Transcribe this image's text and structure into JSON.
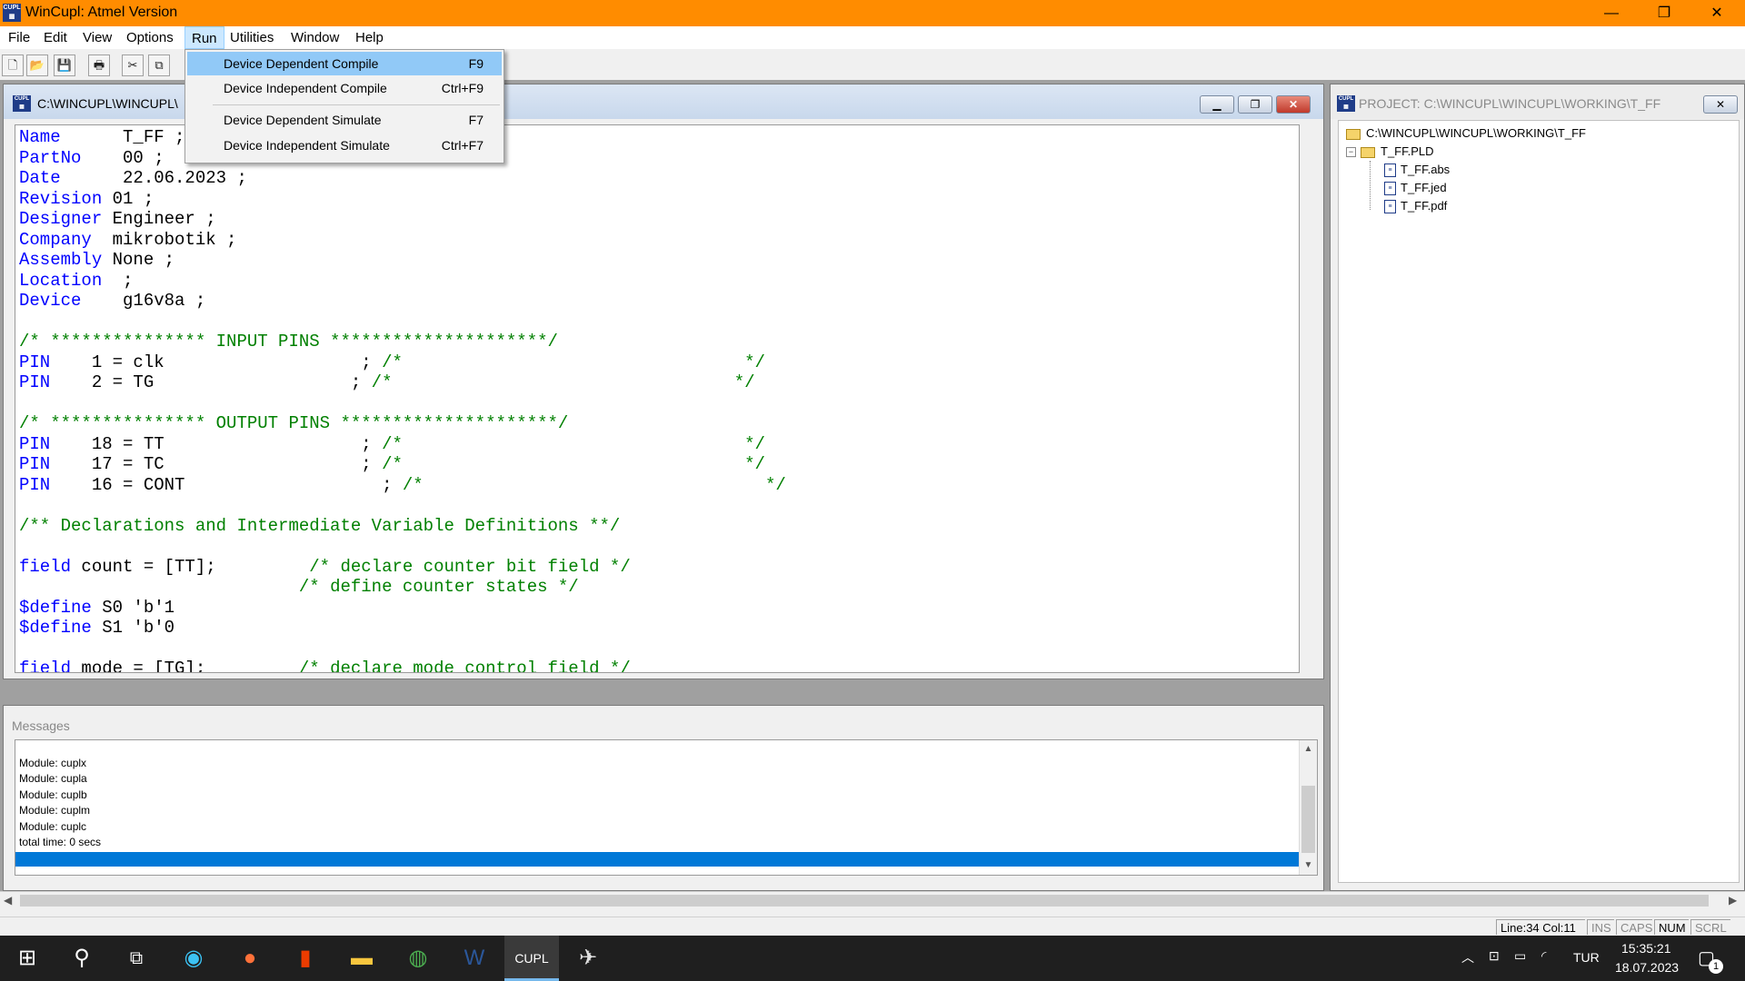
{
  "window": {
    "title": "WinCupl:  Atmel Version",
    "minimize": "—",
    "maximize": "❐",
    "close": "✕"
  },
  "menu": [
    "File",
    "Edit",
    "View",
    "Options",
    "Run",
    "Utilities",
    "Window",
    "Help"
  ],
  "run_menu": [
    {
      "label": "Device Dependent Compile",
      "shortcut": "F9"
    },
    {
      "label": "Device Independent Compile",
      "shortcut": "Ctrl+F9"
    },
    {
      "label": "Device Dependent Simulate",
      "shortcut": "F7"
    },
    {
      "label": "Device Independent Simulate",
      "shortcut": "Ctrl+F7"
    }
  ],
  "toolbar_icons": [
    "new-icon",
    "open-icon",
    "save-icon",
    "print-icon",
    "cut-icon",
    "copy-icon"
  ],
  "editor": {
    "title": "C:\\WINCUPL\\WINCUPL\\",
    "lines": [
      {
        "k": "Name",
        "r": "      T_FF ;"
      },
      {
        "k": "PartNo",
        "r": "    00 ;"
      },
      {
        "k": "Date",
        "r": "      22.06.2023 ;"
      },
      {
        "k": "Revision",
        "r": " 01 ;"
      },
      {
        "k": "Designer",
        "r": " Engineer ;"
      },
      {
        "k": "Company",
        "r": "  mikrobotik ;"
      },
      {
        "k": "Assembly",
        "r": " None ;"
      },
      {
        "k": "Location",
        "r": "  ;"
      },
      {
        "k": "Device",
        "r": "    g16v8a ;"
      },
      {
        "k": "",
        "r": ""
      },
      {
        "c": "/* *************** INPUT PINS *********************/"
      },
      {
        "k": "PIN",
        "r": "    1 = clk                   ;",
        "c2": " /*                                 */"
      },
      {
        "k": "PIN",
        "r": "    2 = TG                   ;",
        "c2": " /*                                 */"
      },
      {
        "k": "",
        "r": ""
      },
      {
        "c": "/* *************** OUTPUT PINS *********************/"
      },
      {
        "k": "PIN",
        "r": "    18 = TT                   ;",
        "c2": " /*                                 */"
      },
      {
        "k": "PIN",
        "r": "    17 = TC                   ;",
        "c2": " /*                                 */"
      },
      {
        "k": "PIN",
        "r": "    16 = CONT                   ;",
        "c2": " /*                                 */"
      },
      {
        "k": "",
        "r": ""
      },
      {
        "c": "/** Declarations and Intermediate Variable Definitions **/"
      },
      {
        "k": "",
        "r": ""
      },
      {
        "k": "field",
        "r": " count = [TT];         ",
        "c2": "/* declare counter bit field */"
      },
      {
        "k": "",
        "r": "                           ",
        "c2": "/* define counter states */"
      },
      {
        "k": "$define",
        "r": " S0 'b'1"
      },
      {
        "k": "$define",
        "r": " S1 'b'0"
      },
      {
        "k": "",
        "r": ""
      },
      {
        "k": "field",
        "r": " mode = [TG];         ",
        "c2": "/* declare mode control field */"
      }
    ]
  },
  "messages": {
    "label": "Messages",
    "lines": [
      "Module: cuplx",
      "Module: cupla",
      "Module: cuplb",
      "Module: cuplm",
      "Module: cuplc",
      "total time: 0 secs"
    ]
  },
  "project": {
    "title": "PROJECT: C:\\WINCUPL\\WINCUPL\\WORKING\\T_FF",
    "root": "C:\\WINCUPL\\WINCUPL\\WORKING\\T_FF",
    "pld": "T_FF.PLD",
    "files": [
      "T_FF.abs",
      "T_FF.jed",
      "T_FF.pdf"
    ]
  },
  "status": {
    "linecol": "Line:34 Col:11",
    "ins": "INS",
    "caps": "CAPS",
    "num": "NUM",
    "scrl": "SCRL"
  },
  "taskbar": {
    "lang": "TUR",
    "time": "15:35:21",
    "date": "18.07.2023",
    "notifications": "1"
  },
  "colors": {
    "titlebar": "#ff8c00",
    "keyword": "#0000ff",
    "comment": "#008000",
    "selection": "#0078d7"
  }
}
